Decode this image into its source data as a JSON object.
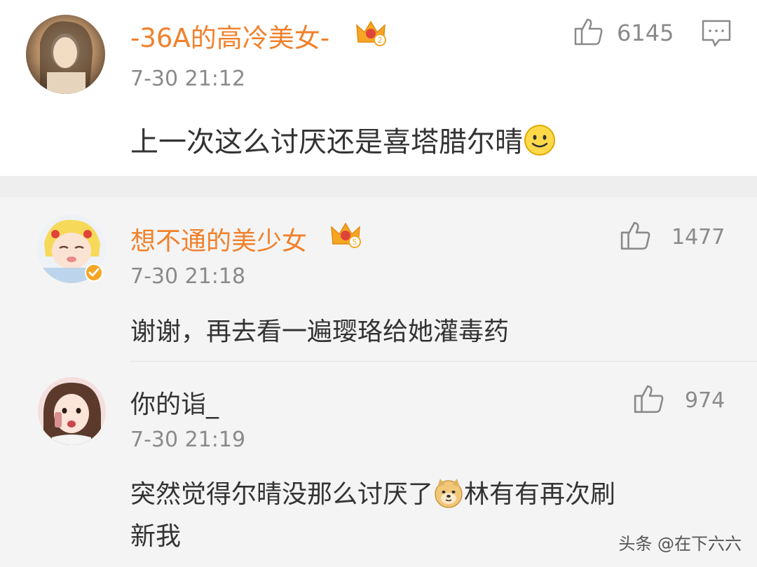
{
  "main_comment": {
    "username": "-36A的高冷美女-",
    "timestamp": "7-30 21:12",
    "text": "上一次这么讨厌还是喜塔腊尔晴",
    "likes": "6145",
    "emoji": "smile-emoji",
    "badge_icon": "crown-icon",
    "username_color": "#f0812c"
  },
  "replies": [
    {
      "username": "想不通的美少女",
      "timestamp": "7-30 21:18",
      "text": "谢谢，再去看一遍璎珞给她灌毒药",
      "likes": "1477",
      "badge_icon": "crown-icon",
      "verified": true,
      "username_color": "#f0812c"
    },
    {
      "username": "你的诣_",
      "timestamp": "7-30 21:19",
      "text_line1_before": "突然觉得尔晴没那么讨厌了",
      "text_line1_after": "林有有再次刷",
      "text_line2": "新我",
      "likes": "974",
      "emoji": "doge-emoji",
      "username_color": "#333333"
    }
  ],
  "watermark": "头条 @在下六六",
  "colors": {
    "accent": "#f0812c",
    "meta": "#8a8a8a",
    "text": "#333333",
    "crown": "#f5a623"
  }
}
